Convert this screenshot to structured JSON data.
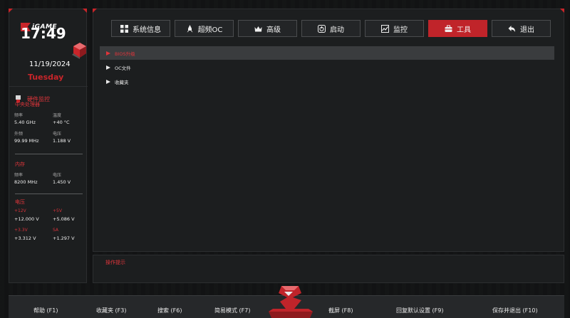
{
  "brand": {
    "logo_text": "iGAME"
  },
  "clock": {
    "time": "17:49",
    "date": "11/19/2024",
    "weekday": "Tuesday"
  },
  "hardware": {
    "title": "硬件监控",
    "cpu": {
      "title": "中央处理器",
      "freq_label": "频率",
      "freq_value": "5.40 GHz",
      "temp_label": "温度",
      "temp_value": "+40 °C",
      "bclk_label": "外频",
      "bclk_value": "99.99 MHz",
      "volt_label": "电压",
      "volt_value": "1.188 V"
    },
    "memory": {
      "title": "内存",
      "freq_label": "频率",
      "freq_value": "8200 MHz",
      "volt_label": "电压",
      "volt_value": "1.450 V"
    },
    "voltage": {
      "title": "电压",
      "v12_label": "+12V",
      "v12_value": "+12.000 V",
      "v5_label": "+5V",
      "v5_value": "+5.086 V",
      "v33_label": "+3.3V",
      "v33_value": "+3.312 V",
      "sa_label": "SA",
      "sa_value": "+1.297 V"
    }
  },
  "tabs": [
    {
      "label": "系统信息",
      "icon": "grid-icon"
    },
    {
      "label": "超频OC",
      "icon": "rocket-icon"
    },
    {
      "label": "高级",
      "icon": "crown-icon"
    },
    {
      "label": "启动",
      "icon": "power-icon"
    },
    {
      "label": "监控",
      "icon": "chart-icon"
    },
    {
      "label": "工具",
      "icon": "toolbox-icon",
      "active": true
    },
    {
      "label": "退出",
      "icon": "back-arrow-icon"
    }
  ],
  "menu": {
    "items": [
      {
        "label": "BIOS升级",
        "selected": true
      },
      {
        "label": "OC文件"
      },
      {
        "label": "收藏夹"
      }
    ]
  },
  "tips": {
    "label": "操作提示"
  },
  "footer": {
    "help": "帮助 (F1)",
    "favorites": "收藏夹 (F3)",
    "search": "搜索 (F6)",
    "easy_mode": "简易模式 (F7)",
    "screenshot": "截屏 (F8)",
    "restore_defaults": "回复默认设置 (F9)",
    "save_exit": "保存并退出 (F10)"
  },
  "colors": {
    "accent": "#c0242a",
    "panel": "#1c1e1f",
    "background": "#121314"
  }
}
